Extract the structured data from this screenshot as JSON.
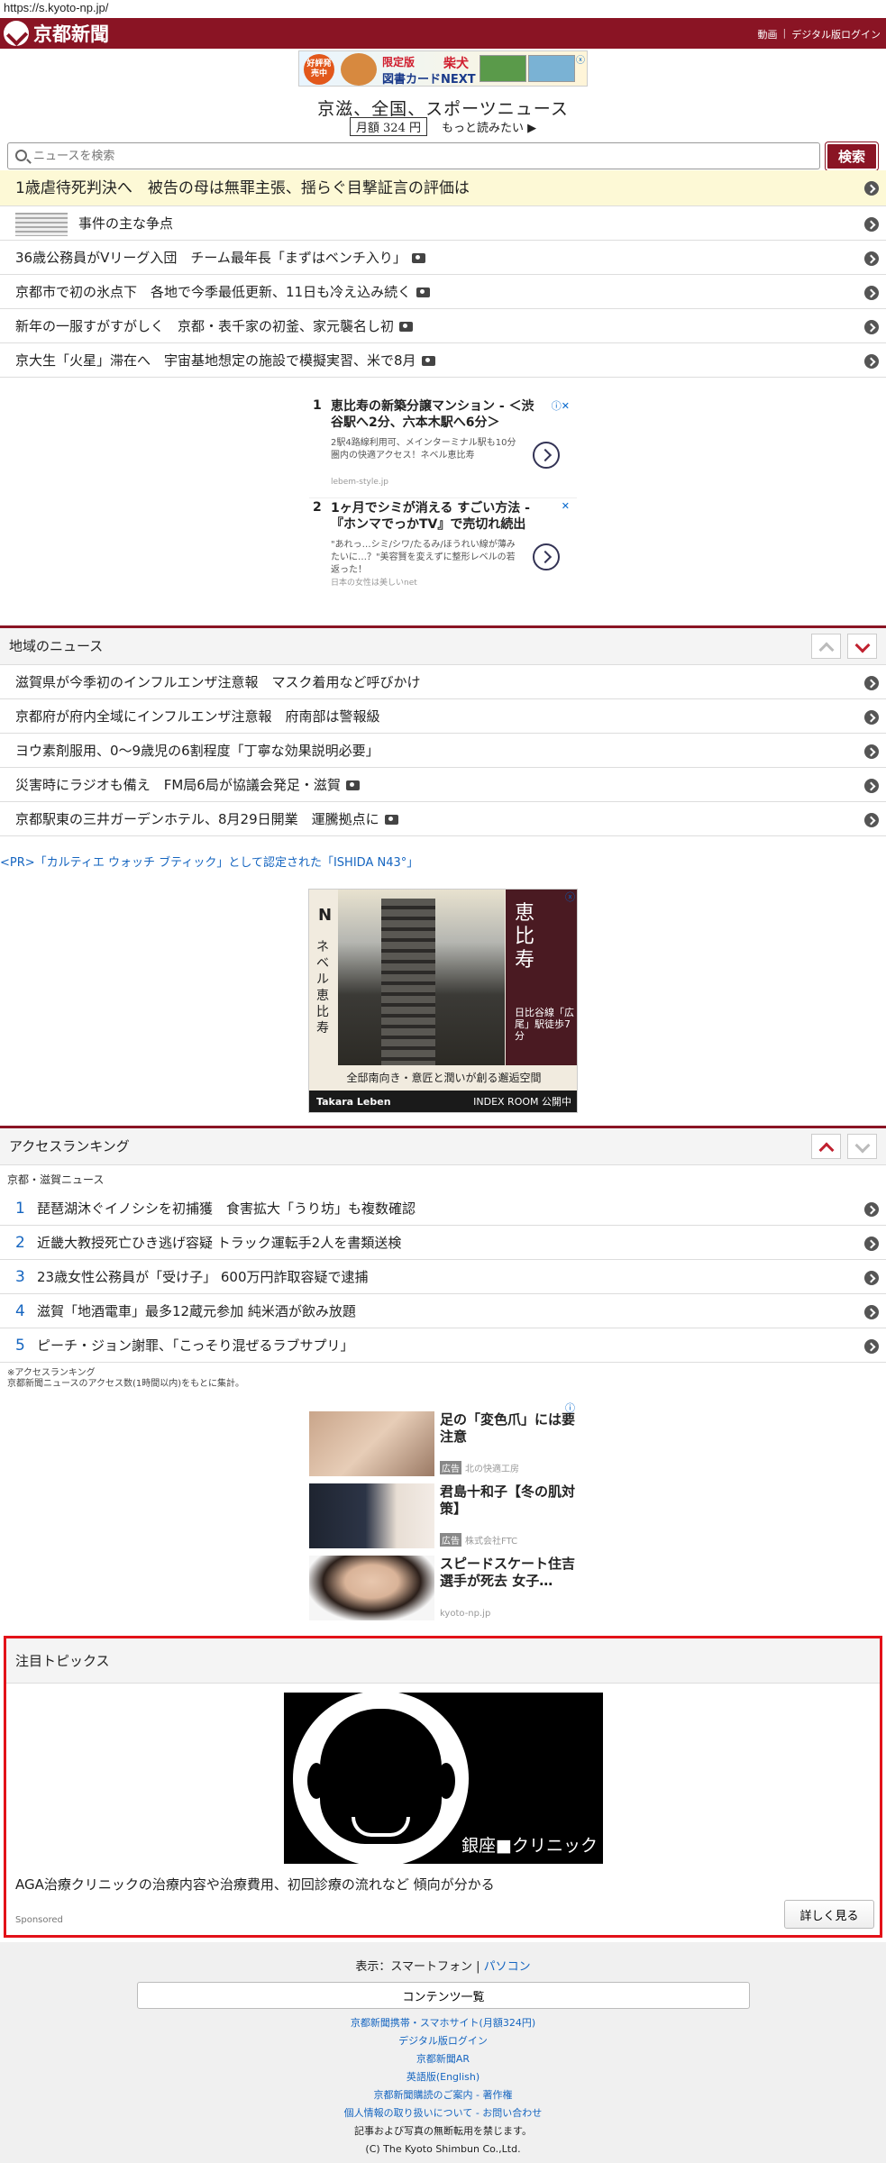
{
  "url": "https://s.kyoto-np.jp/",
  "header": {
    "logo": "京都新聞",
    "links": [
      "動画",
      "デジタル版ログイン"
    ]
  },
  "top_ad": {
    "badge": "好評発売中",
    "label1": "限定版",
    "name": "柴犬",
    "label2": "図書カードNEXT",
    "close": "ⓧ"
  },
  "tagline": "京滋、全国、スポーツニュース",
  "price": "月額 324 円",
  "read_more": "もっと読みたい ▶",
  "search": {
    "placeholder": "ニュースを検索",
    "button": "検索"
  },
  "headlines": [
    "1歳虐待死判決へ　被告の母は無罪主張、揺らぐ目撃証言の評価は",
    "事件の主な争点",
    "36歳公務員がVリーグ入団　チーム最年長「まずはベンチ入り」",
    "京都市で初の氷点下　各地で今季最低更新、11日も冷え込み続く",
    "新年の一服すがすがしく　京都・表千家の初釜、家元襲名し初",
    "京大生「火星」滞在へ　宇宙基地想定の施設で模擬実習、米で8月"
  ],
  "text_ads": [
    {
      "num": "1",
      "title": "恵比寿の新築分譲マンション - ＜渋谷駅へ2分、六本木駅へ6分＞",
      "body": "2駅4路線利用可、メインターミナル駅も10分圏内の快適アクセス！ネベル恵比寿",
      "src": "lebem-style.jp"
    },
    {
      "num": "2",
      "title": "1ヶ月でシミが消える すごい方法 - 『ホンマでっかTV』で売切れ続出",
      "body": "\"あれっ…シミ/シワ/たるみ/ほうれい線が薄みたいに…？\"美容賢を変えずに整形レベルの若返った！",
      "src": "日本の女性は美しいnet"
    }
  ],
  "regional": {
    "title": "地域のニュース",
    "items": [
      "滋賀県が今季初のインフルエンザ注意報　マスク着用など呼びかけ",
      "京都府が府内全域にインフルエンザ注意報　府南部は警報級",
      "ヨウ素剤服用、0〜9歳児の6割程度「丁寧な効果説明必要」",
      "災害時にラジオも備え　FM局6局が協議会発足・滋賀",
      "京都駅東の三井ガーデンホテル、8月29日開業　運騰拠点に"
    ]
  },
  "pr_link": "<PR>「カルティエ ウォッチ ブティック」として認定された「ISHIDA N43°」",
  "display_ad": {
    "logo": "N",
    "brand_vertical": "ネベル恵比寿",
    "right": "恵比寿",
    "right2": "日比谷線「広尾」駅徒歩7分",
    "caption": "全邸南向き・意匠と潤いが創る邂逅空間",
    "foot_left": "Takara Leben",
    "foot_right": "INDEX ROOM 公開中",
    "close": "ⓧ"
  },
  "ranking": {
    "title": "アクセスランキング",
    "sub": "京都・滋賀ニュース",
    "items": [
      {
        "n": "1",
        "t": "琵琶湖沐ぐイノシシを初捕獲　食害拡大「うり坊」も複数確認"
      },
      {
        "n": "2",
        "t": "近畿大教授死亡ひき逃げ容疑 トラック運転手2人を書類送検"
      },
      {
        "n": "3",
        "t": "23歳女性公務員が「受け子」 600万円詐取容疑で逮捕"
      },
      {
        "n": "4",
        "t": "滋賀「地酒電車」最多12蔵元参加 純米酒が飲み放題"
      },
      {
        "n": "5",
        "t": "ピーチ・ジョン謝罪、「こっそり混ぜるラブサプリ」"
      }
    ],
    "note1": "※アクセスランキング",
    "note2": "京都新聞ニュースのアクセス数(1時間以内)をもとに集計。"
  },
  "native_ads": [
    {
      "title": "足の「変色爪」には要注意",
      "badge": "広告",
      "src": "北の快適工房"
    },
    {
      "title": "君島十和子【冬の肌対策】",
      "badge": "広告",
      "src": "株式会社FTC"
    },
    {
      "title": "スピードスケート住吉選手が死去 女子…",
      "badge": "",
      "src": "kyoto-np.jp"
    }
  ],
  "topics": {
    "title": "注目トピックス",
    "brand": "銀座■クリニック",
    "desc": "AGA治療クリニックの治療内容や治療費用、初回診療の流れなど 傾向が分かる",
    "sponsored": "Sponsored",
    "more": "詳しく見る"
  },
  "footer": {
    "display_label": "表示：",
    "smartphone": "スマートフォン",
    "sep": "|",
    "pc": "パソコン",
    "contents": "コンテンツ一覧",
    "links": [
      "京都新聞携帯・スマホサイト(月額324円)",
      "デジタル版ログイン",
      "京都新聞AR",
      "英語版(English)",
      "京都新聞購読のご案内 - 著作権",
      "個人情報の取り扱いについて - お問い合わせ"
    ],
    "rights": "記事および写真の無断転用を禁じます。",
    "copyright": "(C) The Kyoto Shimbun Co.,Ltd."
  }
}
